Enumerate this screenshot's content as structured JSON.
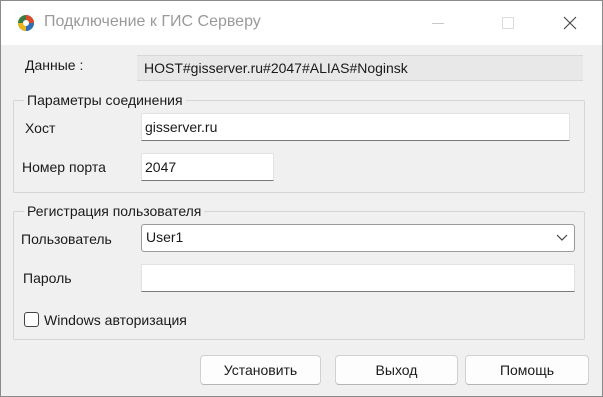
{
  "window": {
    "title": "Подключение к ГИС Серверу"
  },
  "data_row": {
    "label": "Данные :",
    "value": "HOST#gisserver.ru#2047#ALIAS#Noginsk"
  },
  "connection": {
    "group_title": "Параметры соединения",
    "host_label": "Хост",
    "host_value": "gisserver.ru",
    "port_label": "Номер порта",
    "port_value": "2047"
  },
  "registration": {
    "group_title": "Регистрация пользователя",
    "user_label": "Пользователь",
    "user_value": "User1",
    "password_label": "Пароль",
    "password_value": "",
    "windows_auth_label": "Windows авторизация",
    "windows_auth_checked": false
  },
  "buttons": {
    "set": "Установить",
    "exit": "Выход",
    "help": "Помощь"
  }
}
